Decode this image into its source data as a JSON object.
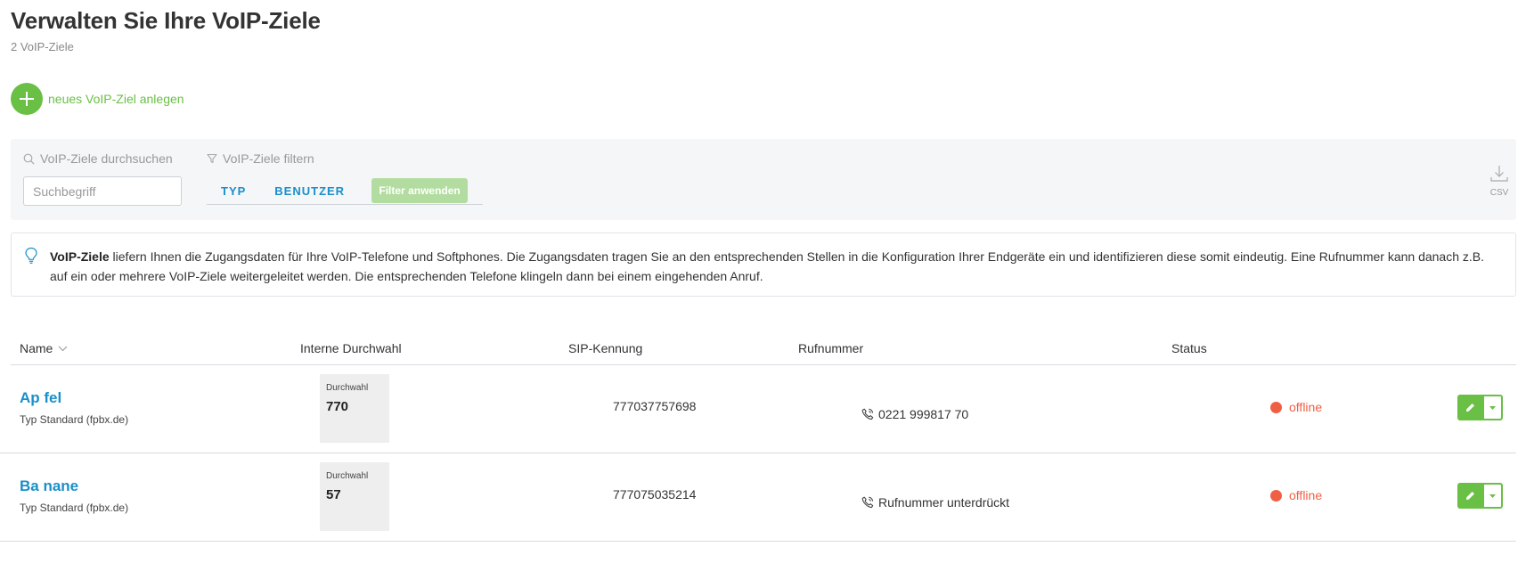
{
  "header": {
    "title": "Verwalten Sie Ihre VoIP-Ziele",
    "subtitle": "2 VoIP-Ziele"
  },
  "add_button": {
    "label": "neues VoIP-Ziel anlegen",
    "icon": "plus-icon"
  },
  "filter_panel": {
    "search_heading": "VoIP-Ziele durchsuchen",
    "search_placeholder": "Suchbegriff",
    "filter_heading": "VoIP-Ziele filtern",
    "tabs": [
      {
        "label": "TYP"
      },
      {
        "label": "BENUTZER"
      }
    ],
    "apply_label": "Filter anwenden",
    "csv_label": "CSV"
  },
  "info": {
    "bold": "VoIP-Ziele",
    "text": " liefern Ihnen die Zugangsdaten für Ihre VoIP-Telefone und Softphones. Die Zugangsdaten tragen Sie an den entsprechenden Stellen in die Konfiguration Ihrer Endgeräte ein und identifizieren diese somit eindeutig. Eine Rufnummer kann danach z.B. auf ein oder mehrere VoIP-Ziele weitergeleitet werden. Die entsprechenden Telefone klingeln dann bei einem eingehenden Anruf."
  },
  "table": {
    "columns": [
      "Name",
      "Interne Durchwahl",
      "SIP-Kennung",
      "Rufnummer",
      "Status"
    ],
    "rows": [
      {
        "name": "Ap fel",
        "type": "Typ Standard (fpbx.de)",
        "extension_label": "Durchwahl",
        "extension": "770",
        "sip": "777037757698",
        "phone": "0221 999817 70",
        "status": "offline"
      },
      {
        "name": "Ba nane",
        "type": "Typ Standard (fpbx.de)",
        "extension_label": "Durchwahl",
        "extension": "57",
        "sip": "777075035214",
        "phone": "Rufnummer unterdrückt",
        "status": "offline"
      }
    ]
  },
  "colors": {
    "accent_green": "#6abf45",
    "link_blue": "#1a8fc9",
    "status_offline": "#f05f44"
  }
}
